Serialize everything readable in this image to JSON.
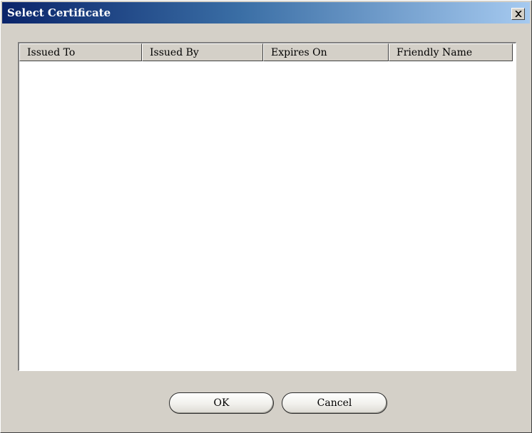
{
  "dialog": {
    "title": "Select Certificate"
  },
  "icons": {
    "close": "close-icon"
  },
  "table": {
    "columns": [
      "Issued To",
      "Issued By",
      "Expires On",
      "Friendly Name"
    ],
    "rows": []
  },
  "buttons": {
    "ok_label": "OK",
    "cancel_label": "Cancel"
  },
  "colors": {
    "title_gradient_start": "#0a246a",
    "title_gradient_end": "#a6caf0",
    "face": "#d4d0c8"
  }
}
